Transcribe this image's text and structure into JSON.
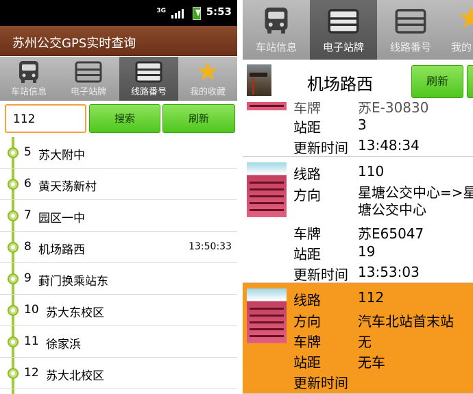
{
  "statusbar": {
    "network": "3G",
    "time": "5:53"
  },
  "app": {
    "title": "苏州公交GPS实时查询"
  },
  "tabs": [
    {
      "label": "车站信息",
      "icon": "bus-icon"
    },
    {
      "label": "电子站牌",
      "icon": "station-board-icon"
    },
    {
      "label": "线路番号",
      "icon": "route-board-icon"
    },
    {
      "label": "我的收藏",
      "icon": "star-icon"
    }
  ],
  "left": {
    "active_tab": 2,
    "search": {
      "value": "112",
      "button": "搜索",
      "refresh": "刷新"
    },
    "stations": [
      {
        "num": "5",
        "name": "苏大附中",
        "time": ""
      },
      {
        "num": "6",
        "name": "黄天荡新村",
        "time": ""
      },
      {
        "num": "7",
        "name": "园区一中",
        "time": ""
      },
      {
        "num": "8",
        "name": "机场路西",
        "time": "13:50:33"
      },
      {
        "num": "9",
        "name": "葑门换乘站东",
        "time": ""
      },
      {
        "num": "10",
        "name": "苏大东校区",
        "time": ""
      },
      {
        "num": "11",
        "name": "徐家浜",
        "time": ""
      },
      {
        "num": "12",
        "name": "苏大北校区",
        "time": ""
      }
    ]
  },
  "right": {
    "active_tab": 1,
    "tab_labels": [
      "车站信息",
      "电子站牌",
      "线路番号",
      "我的"
    ],
    "station_name": "机场路西",
    "refresh": "刷新",
    "labels": {
      "route": "线路",
      "direction": "方向",
      "plate": "车牌",
      "distance": "站距",
      "updated": "更新时间"
    },
    "cards": [
      {
        "plate": "苏E-30830",
        "distance": "3",
        "updated": "13:48:34",
        "highlight": false
      },
      {
        "route": "110",
        "direction": "星塘公交中心=>星塘公交中心",
        "plate": "苏E65047",
        "distance": "19",
        "updated": "13:53:03",
        "highlight": false
      },
      {
        "route": "112",
        "direction": "汽车北站首末站",
        "plate": "无",
        "distance": "无车",
        "updated": "",
        "highlight": true
      }
    ]
  },
  "colors": {
    "title_bar": "#7a3d22",
    "accent_green": "#5ccf27",
    "highlight_orange": "#f59a1e",
    "rail_green": "#9ccc38"
  }
}
